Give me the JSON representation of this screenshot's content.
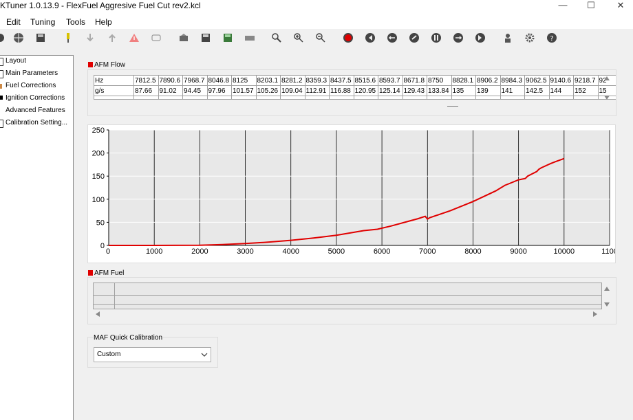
{
  "window": {
    "title": "KTuner 1.0.13.9 - FlexFuel Aggresive Fuel Cut rev2.kcl"
  },
  "menu": [
    "Edit",
    "Tuning",
    "Tools",
    "Help"
  ],
  "toolbar_icons": [
    "open-icon",
    "globe-icon",
    "save-disk-icon",
    "connect-plug-icon",
    "download-arrow-icon",
    "upload-arrow-icon",
    "warning-icon",
    "blank-icon",
    "datalog-icon",
    "save-icon",
    "save-green-icon",
    "flash-icon",
    "zoom-icon",
    "zoom-in-icon",
    "zoom-out-icon",
    "record-icon",
    "rewind-icon",
    "back-icon",
    "play-icon",
    "pause-icon",
    "forward-icon",
    "end-icon",
    "person-icon",
    "gear-icon",
    "help-icon"
  ],
  "sidebar": {
    "items": [
      {
        "label": "Layout"
      },
      {
        "label": "Main Parameters"
      },
      {
        "label": "Fuel Corrections"
      },
      {
        "label": "Ignition Corrections"
      },
      {
        "label": "Advanced Features"
      },
      {
        "label": "Calibration Setting..."
      }
    ]
  },
  "afm_flow": {
    "label": "AFM Flow",
    "row_labels": [
      "Hz",
      "g/s"
    ],
    "hz": [
      "7812.5",
      "7890.6",
      "7968.7",
      "8046.8",
      "8125",
      "8203.1",
      "8281.2",
      "8359.3",
      "8437.5",
      "8515.6",
      "8593.7",
      "8671.8",
      "8750",
      "8828.1",
      "8906.2",
      "8984.3",
      "9062.5",
      "9140.6",
      "9218.7",
      "92"
    ],
    "gs": [
      "87.66",
      "91.02",
      "94.45",
      "97.96",
      "101.57",
      "105.26",
      "109.04",
      "112.91",
      "116.88",
      "120.95",
      "125.14",
      "129.43",
      "133.84",
      "135",
      "139",
      "141",
      "142.5",
      "144",
      "152",
      "15"
    ]
  },
  "chart_data": {
    "type": "line",
    "x_ticks": [
      0,
      1000,
      2000,
      3000,
      4000,
      5000,
      6000,
      7000,
      8000,
      9000,
      10000,
      "1100"
    ],
    "y_ticks": [
      0,
      50,
      100,
      150,
      200,
      250
    ],
    "xlim": [
      0,
      11000
    ],
    "ylim": [
      0,
      250
    ],
    "grid": true,
    "colors": {
      "line": "#e00000",
      "plot_bg": "#e8e8e8"
    },
    "series": [
      {
        "x": [
          0,
          1000,
          2000,
          2500,
          3000,
          3500,
          4000,
          4500,
          5000,
          5300,
          5600,
          5900,
          6200,
          6500,
          6800,
          6950,
          7000,
          7050,
          7500,
          8000,
          8500,
          8700,
          8800,
          9000,
          9150,
          9200,
          9400,
          9450,
          9500,
          9700,
          9800,
          10000
        ],
        "y": [
          0,
          0,
          0.5,
          2,
          4,
          7,
          11,
          16,
          22,
          27,
          32,
          35,
          42,
          50,
          58,
          63,
          57,
          60,
          75,
          95,
          118,
          130,
          134,
          142,
          145,
          150,
          160,
          165,
          168,
          177,
          181,
          188
        ]
      }
    ]
  },
  "afm_fuel": {
    "label": "AFM Fuel"
  },
  "maf_quick": {
    "label": "MAF Quick Calibration",
    "selected": "Custom"
  }
}
